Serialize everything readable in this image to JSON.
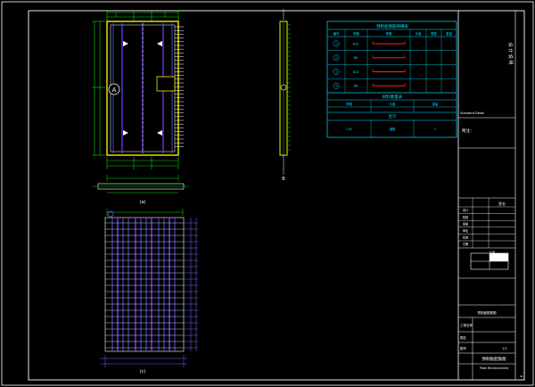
{
  "colors": {
    "background": "#000000",
    "frame": "#ffffff",
    "rebar_blue": "#6a6aff",
    "rebar_purple": "#7a3cff",
    "dim_green": "#00e000",
    "dim_yellow": "#f0f000",
    "table_cyan": "#00e0ff",
    "highlight_red": "#ff2020"
  },
  "drawing": {
    "plan_label": "(a)",
    "elevation_label": "(c)",
    "section_mark": "A",
    "side_mark": "B"
  },
  "rebar_table": {
    "title": "预制板钢筋明细表",
    "headers": [
      "编号",
      "规格",
      "简图",
      "长度",
      "根数",
      "重量"
    ],
    "rows": [
      {
        "id": "1",
        "spec": "Φ10"
      },
      {
        "id": "2",
        "spec": "Φ8"
      },
      {
        "id": "3",
        "spec": "Φ10"
      },
      {
        "id": "4",
        "spec": "Φ8"
      }
    ],
    "material_title": "材料数量表",
    "material_headers": [
      "规格",
      "长度",
      "重量"
    ],
    "summary_title": "合计",
    "summary_cells": [
      "C30",
      "钢筋",
      "1"
    ]
  },
  "title_block": {
    "vertical_note": "设 计 说 明",
    "small_label": "Standard Detail",
    "notes_label": "附注：",
    "sign_rows": [
      "设计",
      "校核",
      "审核",
      "审定",
      "批准",
      "日期"
    ],
    "sign_col2": "签名",
    "scale_label": "比例",
    "drawing_name": "预制板配筋图",
    "project_label": "工程名称",
    "sheet_label": "图名",
    "no_label": "图号",
    "footer_label": "Plate Reinforcement",
    "sheet_no": "01",
    "page_no": "1/1"
  }
}
